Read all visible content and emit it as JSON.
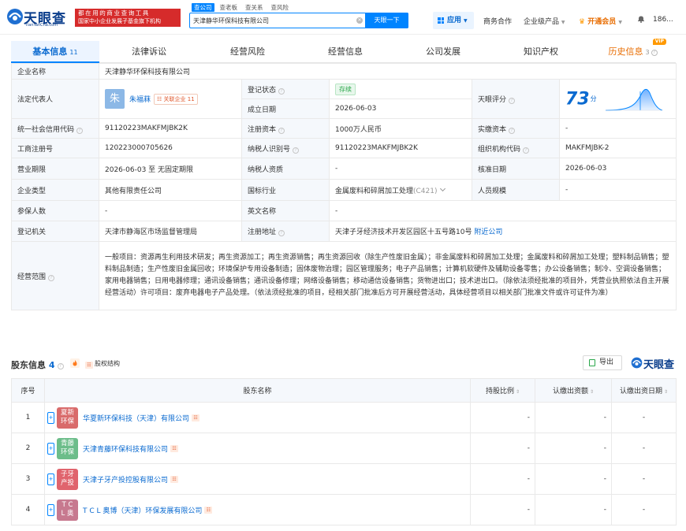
{
  "header": {
    "logo_text": "天眼查",
    "logo_sub": "TianYanCha.com",
    "slogan_line1": "都在用的商业查询工具",
    "slogan_line2": "国家中小企业发展子基金旗下机构",
    "search_tabs": [
      "查公司",
      "查老板",
      "查关系",
      "查风险"
    ],
    "search_value": "天津静华环保科技有限公司",
    "search_button": "天眼一下",
    "app_button": "应用",
    "nav_items": [
      "商务合作",
      "企业级产品"
    ],
    "vip_label": "开通会员",
    "user_label": "186..."
  },
  "tabs": [
    {
      "label": "基本信息",
      "count": "11"
    },
    {
      "label": "法律诉讼"
    },
    {
      "label": "经营风险"
    },
    {
      "label": "经营信息"
    },
    {
      "label": "公司发展"
    },
    {
      "label": "知识产权"
    },
    {
      "label": "历史信息",
      "count": "3",
      "badge": "VIP"
    }
  ],
  "info": {
    "company_name_label": "企业名称",
    "company_name": "天津静华环保科技有限公司",
    "legal_rep_label": "法定代表人",
    "legal_rep_avatar": "朱",
    "legal_rep_name": "朱福菻",
    "legal_rep_badge": "关联企业 11",
    "reg_status_label": "登记状态",
    "reg_status": "存续",
    "established_label": "成立日期",
    "established": "2026-06-03",
    "score_label": "天眼评分",
    "score": "73",
    "score_unit": "分",
    "credit_code_label": "统一社会信用代码",
    "credit_code": "91120223MAKFMJBK2K",
    "reg_capital_label": "注册资本",
    "reg_capital": "1000万人民币",
    "paid_capital_label": "实缴资本",
    "paid_capital": "-",
    "reg_no_label": "工商注册号",
    "reg_no": "120223000705626",
    "taxpayer_id_label": "纳税人识别号",
    "taxpayer_id": "91120223MAKFMJBK2K",
    "org_code_label": "组织机构代码",
    "org_code": "MAKFMJBK-2",
    "term_label": "营业期限",
    "term": "2026-06-03 至 无固定期限",
    "taxpayer_qual_label": "纳税人资质",
    "taxpayer_qual": "-",
    "approval_date_label": "核准日期",
    "approval_date": "2026-06-03",
    "type_label": "企业类型",
    "type": "其他有限责任公司",
    "industry_label": "国标行业",
    "industry": "金属废料和碎屑加工处理",
    "industry_code": "(C421)",
    "staff_label": "人员规模",
    "staff": "-",
    "insured_label": "参保人数",
    "insured": "-",
    "english_name_label": "英文名称",
    "english_name": "-",
    "authority_label": "登记机关",
    "authority": "天津市静海区市场监督管理局",
    "address_label": "注册地址",
    "address": "天津子牙经济技术开发区园区十五号路10号",
    "nearby_link": "附近公司",
    "scope_label": "经营范围",
    "scope": "一般项目：资源再生利用技术研发；再生资源加工；再生资源销售；再生资源回收（除生产性废旧金属）；非金属废料和碎屑加工处理；金属废料和碎屑加工处理；塑料制品销售；塑料制品制造；生产性废旧金属回收；环境保护专用设备制造；固体废物治理；园区管理服务；电子产品销售；计算机软硬件及辅助设备零售；办公设备销售；制冷、空调设备销售；家用电器销售；日用电器修理；通讯设备销售；通讯设备修理；网络设备销售；移动通信设备销售；货物进出口；技术进出口。（除依法须经批准的项目外，凭营业执照依法自主开展经营活动）许可项目：废弃电器电子产品处理。（依法须经批准的项目，经相关部门批准后方可开展经营活动，具体经营项目以相关部门批准文件或许可证件为准）"
  },
  "shareholders": {
    "title": "股东信息",
    "count": "4",
    "equity_link": "股权结构",
    "export_label": "导出",
    "brand": "天眼查",
    "columns": [
      "序号",
      "股东名称",
      "持股比例",
      "认缴出资额",
      "认缴出资日期"
    ],
    "rows": [
      {
        "no": "1",
        "logo": "夏新\n环保",
        "logo_color": "#d96b6b",
        "name": "华夏新环保科技（天津）有限公司",
        "ratio": "-",
        "amount": "-",
        "date": "-"
      },
      {
        "no": "2",
        "logo": "青藤\n环保",
        "logo_color": "#6cbd8a",
        "name": "天津青藤环保科技有限公司",
        "ratio": "-",
        "amount": "-",
        "date": "-"
      },
      {
        "no": "3",
        "logo": "子牙\n产投",
        "logo_color": "#e0646d",
        "name": "天津子牙产投控股有限公司",
        "ratio": "-",
        "amount": "-",
        "date": "-"
      },
      {
        "no": "4",
        "logo": "T C\nL 奥",
        "logo_color": "#c7798f",
        "name": "T C L 奥博（天津）环保发展有限公司",
        "ratio": "-",
        "amount": "-",
        "date": "-"
      }
    ]
  },
  "colors": {
    "brand_blue": "#0084ff",
    "link_blue": "#0a6ad0",
    "status_green": "#2aa74a",
    "vip_orange": "#e86c00"
  }
}
